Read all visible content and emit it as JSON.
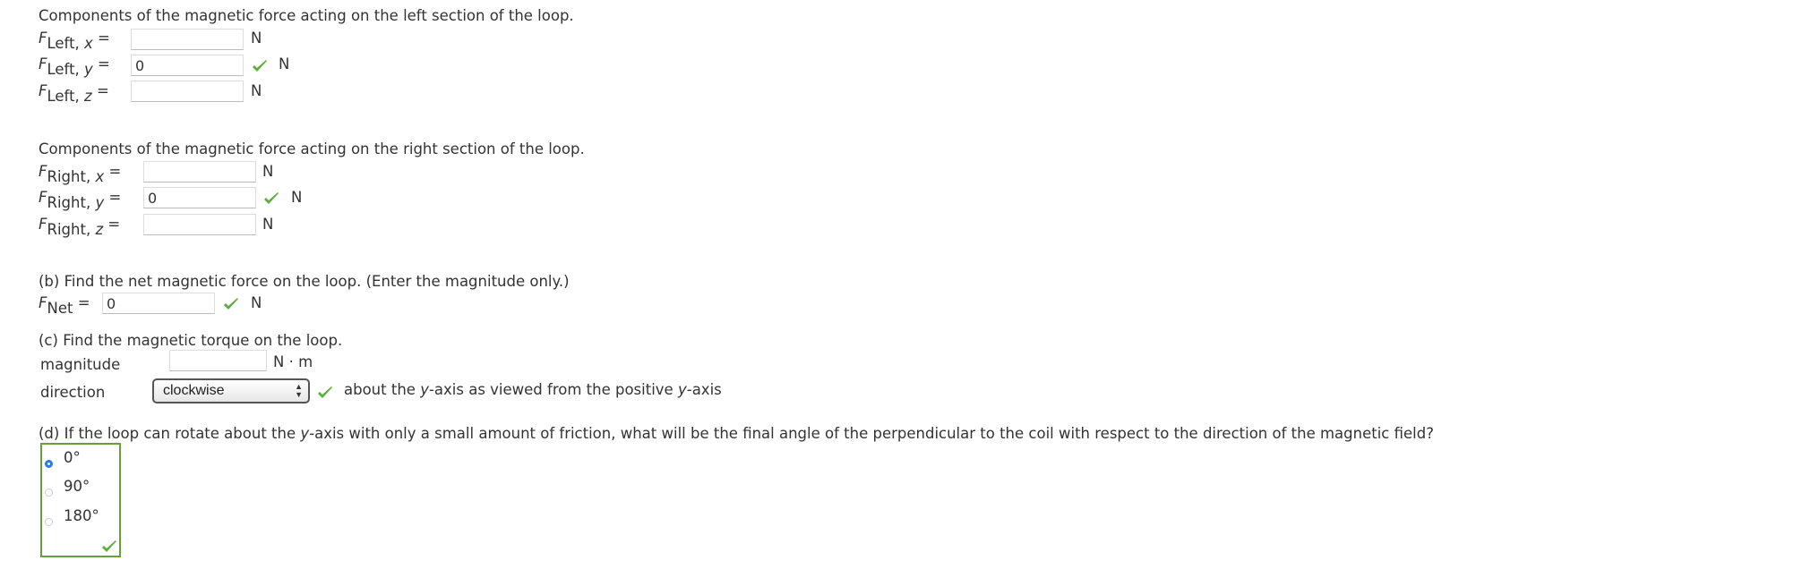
{
  "left_section": {
    "heading": "Components of the magnetic force acting on the left section of the loop.",
    "rows": [
      {
        "sym": "F",
        "sub": "Left, ",
        "axis": "x",
        "value": "",
        "unit": "N",
        "correct": false
      },
      {
        "sym": "F",
        "sub": "Left, ",
        "axis": "y",
        "value": "0",
        "unit": "N",
        "correct": true
      },
      {
        "sym": "F",
        "sub": "Left, ",
        "axis": "z",
        "value": "",
        "unit": "N",
        "correct": false
      }
    ]
  },
  "right_section": {
    "heading": "Components of the magnetic force acting on the right section of the loop.",
    "rows": [
      {
        "sym": "F",
        "sub": "Right, ",
        "axis": "x",
        "value": "",
        "unit": "N",
        "correct": false
      },
      {
        "sym": "F",
        "sub": "Right, ",
        "axis": "y",
        "value": "0",
        "unit": "N",
        "correct": true
      },
      {
        "sym": "F",
        "sub": "Right, ",
        "axis": "z",
        "value": "",
        "unit": "N",
        "correct": false
      }
    ]
  },
  "part_b": {
    "question": "(b) Find the net magnetic force on the loop. (Enter the magnitude only.)",
    "sym": "F",
    "sub": "Net",
    "value": "0",
    "unit": "N"
  },
  "part_c": {
    "question": "(c) Find the magnetic torque on the loop.",
    "magnitude_label": "magnitude",
    "magnitude_value": "",
    "magnitude_unit": "N · m",
    "direction_label": "direction",
    "direction_selected": "clockwise",
    "direction_suffix_1": "about the ",
    "direction_axis_1": "y",
    "direction_suffix_2": "-axis as viewed from the positive ",
    "direction_axis_2": "y",
    "direction_suffix_3": "-axis"
  },
  "part_d": {
    "question_1": "(d) If the loop can rotate about the ",
    "question_axis": "y",
    "question_2": "-axis with only a small amount of friction, what will be the final angle of the perpendicular to the coil with respect to the direction of the magnetic field?",
    "options": [
      "0°",
      "90°",
      "180°"
    ],
    "selected": "0°"
  },
  "colors": {
    "correct_check": "#5cad3c",
    "answer_box_border": "#6a9e3a",
    "radio_selected": "#2a7be4"
  }
}
